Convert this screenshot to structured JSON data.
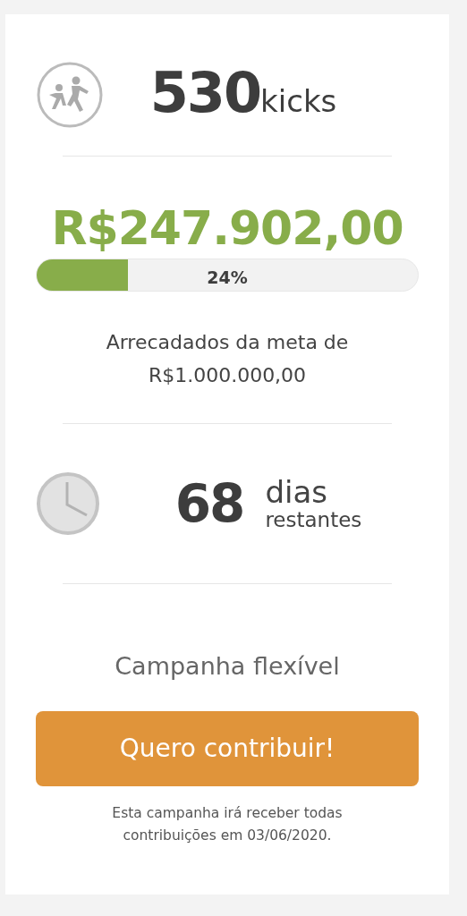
{
  "backers": {
    "count": "530",
    "unit": "kicks"
  },
  "raised": {
    "amount": "R$247.902,00",
    "level": 0.24,
    "percent": "24%",
    "goal_text": "Arrecadados da meta de R$1.000.000,00"
  },
  "time_left": {
    "count": "68",
    "unit": "dias",
    "caption": "restantes"
  },
  "campaign_type": "Campanha flexível",
  "cta_button": "Quero contribuir!",
  "note": "Esta campanha irá receber todas contribuições em 03/06/2020."
}
